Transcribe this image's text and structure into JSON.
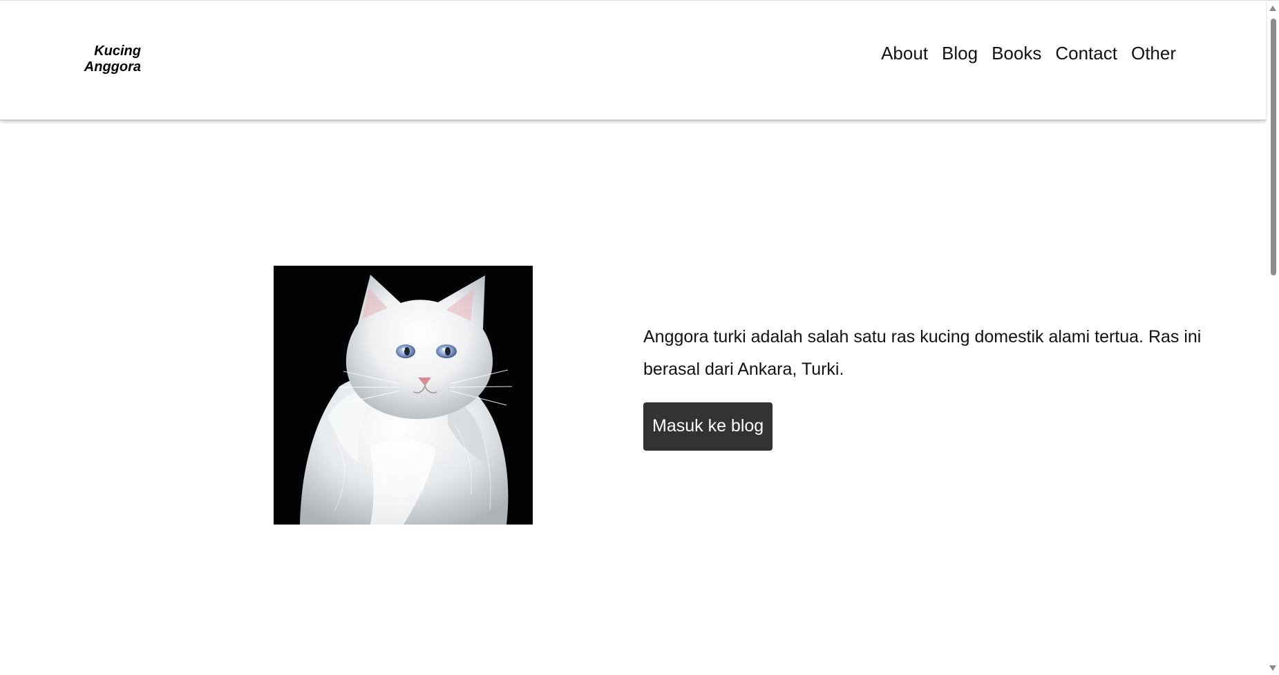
{
  "header": {
    "logo_line1": "Kucing",
    "logo_line2": "Anggora",
    "nav": [
      {
        "label": "About"
      },
      {
        "label": "Blog"
      },
      {
        "label": "Books"
      },
      {
        "label": "Contact"
      },
      {
        "label": "Other"
      }
    ]
  },
  "hero": {
    "description": "Anggora turki adalah salah satu ras kucing domestik alami tertua. Ras ini berasal dari Ankara, Turki.",
    "button_label": "Masuk ke blog"
  },
  "colors": {
    "button_background": "#333333",
    "text": "#111111",
    "photo_background": "#020304"
  },
  "icons": {
    "scroll_up": "scroll-up-arrow-icon",
    "scroll_down": "scroll-down-arrow-icon"
  }
}
